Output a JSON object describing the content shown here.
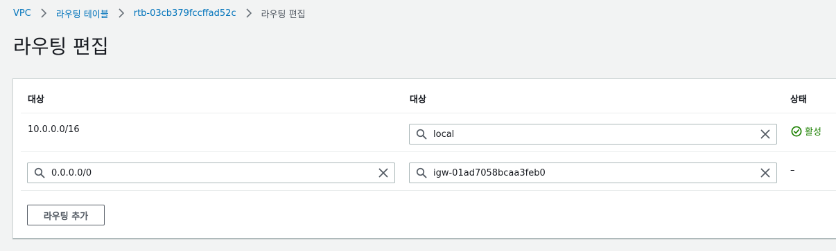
{
  "breadcrumb": {
    "items": [
      {
        "label": "VPC"
      },
      {
        "label": "라우팅 테이블"
      },
      {
        "label": "rtb-03cb379fccffad52c"
      }
    ],
    "current": "라우팅 편집"
  },
  "page": {
    "title": "라우팅 편집"
  },
  "table": {
    "headers": {
      "destination": "대상",
      "target": "대상",
      "status": "상태"
    },
    "rows": [
      {
        "destination": "10.0.0.0/16",
        "target": "local",
        "status": "활성"
      },
      {
        "destination": "0.0.0.0/0",
        "target": "igw-01ad7058bcaa3feb0",
        "status": "–"
      }
    ]
  },
  "actions": {
    "add_route_label": "라우팅 추가"
  },
  "colors": {
    "link": "#0073bb",
    "status_active": "#1d8102",
    "background": "#f2f3f3",
    "border": "#aab7b8"
  },
  "icons": {
    "separator": "chevron-right-icon",
    "search": "search-icon",
    "clear": "close-icon",
    "status": "check-circle-icon"
  }
}
